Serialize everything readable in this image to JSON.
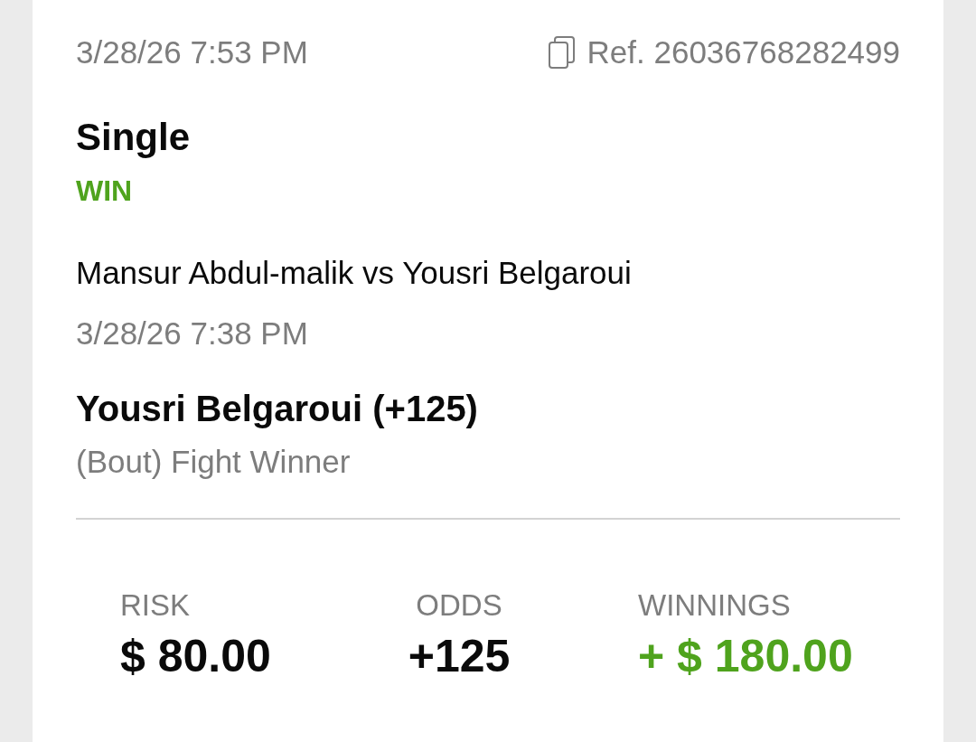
{
  "bet": {
    "placed_time": "3/28/26 7:53 PM",
    "reference": "Ref. 26036768282499",
    "type": "Single",
    "result": "WIN",
    "event": "Mansur Abdul-malik vs Yousri Belgaroui",
    "event_time": "3/28/26 7:38 PM",
    "selection": "Yousri Belgaroui (+125)",
    "market": "(Bout) Fight Winner"
  },
  "summary": [
    {
      "label": "RISK",
      "value": "$ 80.00"
    },
    {
      "label": "ODDS",
      "value": "+125"
    },
    {
      "label": "WINNINGS",
      "value": "+ $ 180.00"
    }
  ]
}
